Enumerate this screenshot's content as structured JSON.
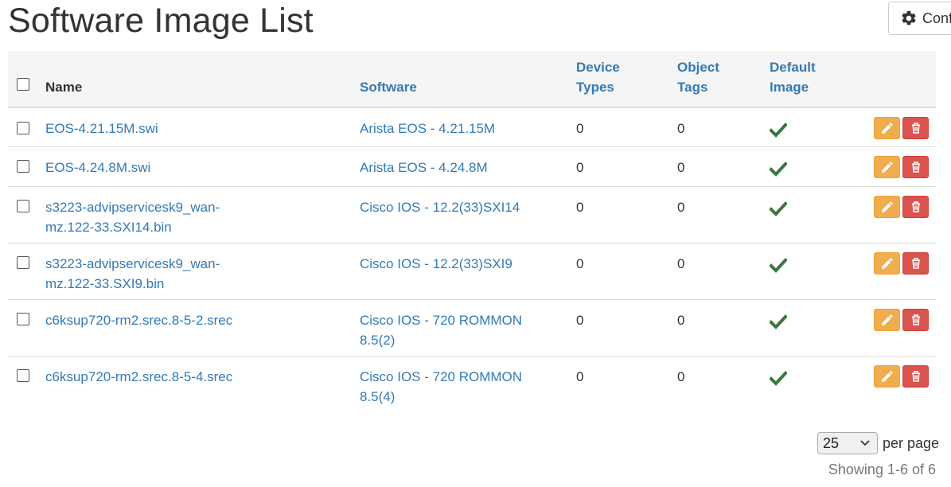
{
  "page": {
    "title": "Software Image List"
  },
  "toolbar": {
    "configure_label": "Conf"
  },
  "table": {
    "headers": {
      "name": "Name",
      "software": "Software",
      "device_types": [
        "Device",
        "Types"
      ],
      "object_tags": [
        "Object",
        "Tags"
      ],
      "default_image": [
        "Default",
        "Image"
      ]
    },
    "rows": [
      {
        "name": [
          "EOS-4.21.15M.swi"
        ],
        "software": [
          "Arista EOS - 4.21.15M"
        ],
        "device_types": "0",
        "object_tags": "0",
        "default_image": true
      },
      {
        "name": [
          "EOS-4.24.8M.swi"
        ],
        "software": [
          "Arista EOS - 4.24.8M"
        ],
        "device_types": "0",
        "object_tags": "0",
        "default_image": true
      },
      {
        "name": [
          "s3223-advipservicesk9_wan-",
          "mz.122-33.SXI14.bin"
        ],
        "software": [
          "Cisco IOS - 12.2(33)SXI14"
        ],
        "device_types": "0",
        "object_tags": "0",
        "default_image": true
      },
      {
        "name": [
          "s3223-advipservicesk9_wan-",
          "mz.122-33.SXI9.bin"
        ],
        "software": [
          "Cisco IOS - 12.2(33)SXI9"
        ],
        "device_types": "0",
        "object_tags": "0",
        "default_image": true
      },
      {
        "name": [
          "c6ksup720-rm2.srec.8-5-2.srec"
        ],
        "software": [
          "Cisco IOS - 720 ROMMON",
          "8.5(2)"
        ],
        "device_types": "0",
        "object_tags": "0",
        "default_image": true
      },
      {
        "name": [
          "c6ksup720-rm2.srec.8-5-4.srec"
        ],
        "software": [
          "Cisco IOS - 720 ROMMON",
          "8.5(4)"
        ],
        "device_types": "0",
        "object_tags": "0",
        "default_image": true
      }
    ]
  },
  "pagination": {
    "per_page_value": "25",
    "per_page_label": "per page",
    "showing_text": "Showing 1-6 of 6"
  },
  "icons": {
    "configure": "gear-icon",
    "default": "checkmark-icon",
    "edit": "pencil-icon",
    "delete": "trash-icon",
    "select": "chevron-down-icon"
  },
  "colors": {
    "link": "#337ab7",
    "check": "#3c763d",
    "edit_button": "#f0ad4e",
    "delete_button": "#d9534f",
    "header_bg": "#f5f5f5"
  }
}
